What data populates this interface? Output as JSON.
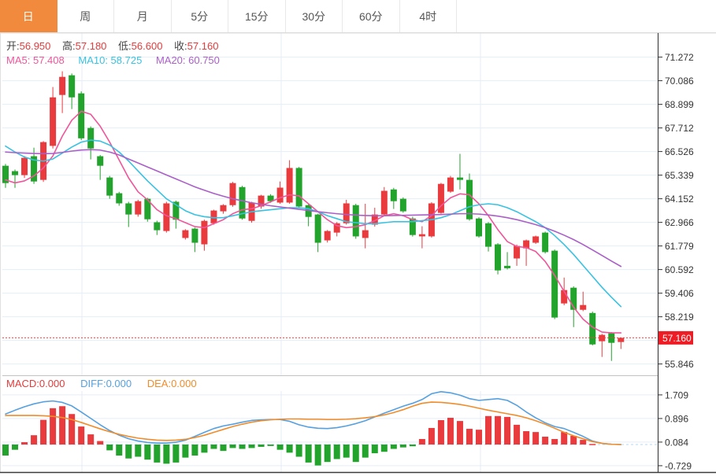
{
  "tabs": [
    {
      "label": "日",
      "key": "day",
      "active": true
    },
    {
      "label": "周",
      "key": "week",
      "active": false
    },
    {
      "label": "月",
      "key": "month",
      "active": false
    },
    {
      "label": "5分",
      "key": "5min",
      "active": false
    },
    {
      "label": "15分",
      "key": "15min",
      "active": false
    },
    {
      "label": "30分",
      "key": "30min",
      "active": false
    },
    {
      "label": "60分",
      "key": "60min",
      "active": false
    },
    {
      "label": "4时",
      "key": "4hour",
      "active": false
    }
  ],
  "ohlc_bar": {
    "open_label": "开:",
    "open": "56.950",
    "high_label": "高:",
    "high": "57.180",
    "low_label": "低:",
    "low": "56.600",
    "close_label": "收:",
    "close": "57.160"
  },
  "ma_legend": {
    "ma5_label": "MA5: ",
    "ma5": "57.408",
    "ma10_label": "MA10: ",
    "ma10": "58.725",
    "ma20_label": "MA20: ",
    "ma20": "60.750"
  },
  "macd_legend": {
    "macd_label": "MACD:",
    "macd": "0.000",
    "diff_label": "DIFF:",
    "diff": "0.000",
    "dea_label": "DEA:",
    "dea": "0.000"
  },
  "price_axis": {
    "ticks": [
      "71.272",
      "70.086",
      "68.899",
      "67.712",
      "66.526",
      "65.339",
      "64.152",
      "62.966",
      "61.779",
      "60.592",
      "59.406",
      "58.219",
      "55.846"
    ],
    "last_price_badge": "57.160"
  },
  "macd_axis": {
    "ticks": [
      "1.709",
      "0.896",
      "0.084",
      "-0.729"
    ]
  },
  "colors": {
    "up": "#e93a3e",
    "down": "#22a32b",
    "ma5": "#f0559a",
    "ma10": "#38c2e2",
    "ma20": "#aa5fc8",
    "diff": "#55a0e0",
    "dea": "#f08c2a",
    "tab_active": "#f28a3e",
    "badge": "#ee1c24",
    "grid": "#e4edf6",
    "axis_line": "#444444",
    "axis_text": "#333333",
    "dotted_line": "#ff3a3a",
    "zero_dash": "#b5d8f0",
    "ohlc_value": "#e33b3c",
    "macd_label": "#e23b3b"
  },
  "chart_data": [
    {
      "type": "candlestick",
      "title": "K-line daily panel",
      "legend_position": "top-left",
      "grid": true,
      "y_axis_ticks": [
        71.272,
        70.086,
        68.899,
        67.712,
        66.526,
        65.339,
        64.152,
        62.966,
        61.779,
        60.592,
        59.406,
        58.219,
        55.846
      ],
      "ylim": [
        55.25,
        72.45
      ],
      "current_price": 57.16,
      "candles_ohlc_hi_lo_close_format": "[open,high,low,close]",
      "candles": [
        [
          65.81,
          65.9,
          64.7,
          64.94
        ],
        [
          65.54,
          65.62,
          64.7,
          65.34
        ],
        [
          65.34,
          66.3,
          65.2,
          66.21
        ],
        [
          66.29,
          66.72,
          64.9,
          65.02
        ],
        [
          65.1,
          67.05,
          65.0,
          67.0
        ],
        [
          66.81,
          69.77,
          66.68,
          69.25
        ],
        [
          69.37,
          70.56,
          68.46,
          70.28
        ],
        [
          70.36,
          70.45,
          68.66,
          69.25
        ],
        [
          69.45,
          69.55,
          67.1,
          67.19
        ],
        [
          67.71,
          67.79,
          66.13,
          66.68
        ],
        [
          66.29,
          66.35,
          65.1,
          65.81
        ],
        [
          65.22,
          65.3,
          64.15,
          64.31
        ],
        [
          64.43,
          64.5,
          63.8,
          63.92
        ],
        [
          63.92,
          64.0,
          62.73,
          63.36
        ],
        [
          63.36,
          64.1,
          63.25,
          64.03
        ],
        [
          64.15,
          64.2,
          63.0,
          63.12
        ],
        [
          62.97,
          63.05,
          62.33,
          62.57
        ],
        [
          62.53,
          64.0,
          62.45,
          63.92
        ],
        [
          64.0,
          64.06,
          62.65,
          63.1
        ],
        [
          62.18,
          62.62,
          62.1,
          62.57
        ],
        [
          62.65,
          62.7,
          61.47,
          61.94
        ],
        [
          61.86,
          63.1,
          61.54,
          63.04
        ],
        [
          62.92,
          63.6,
          62.85,
          63.56
        ],
        [
          63.52,
          63.88,
          63.4,
          63.83
        ],
        [
          63.83,
          65.0,
          63.75,
          64.94
        ],
        [
          64.74,
          64.8,
          63.1,
          63.16
        ],
        [
          63.04,
          64.0,
          62.95,
          63.96
        ],
        [
          63.76,
          64.35,
          63.65,
          64.31
        ],
        [
          64.31,
          64.38,
          63.95,
          64.03
        ],
        [
          63.96,
          65.02,
          63.9,
          64.71
        ],
        [
          63.96,
          66.09,
          63.9,
          65.7
        ],
        [
          65.7,
          65.75,
          63.7,
          63.76
        ],
        [
          63.83,
          63.9,
          62.77,
          63.24
        ],
        [
          63.36,
          63.4,
          61.47,
          61.94
        ],
        [
          62.06,
          62.58,
          61.95,
          62.53
        ],
        [
          62.45,
          62.98,
          62.26,
          62.92
        ],
        [
          62.92,
          64.1,
          62.85,
          63.92
        ],
        [
          63.83,
          63.9,
          62.14,
          62.26
        ],
        [
          62.18,
          63.9,
          61.66,
          62.57
        ],
        [
          62.85,
          63.7,
          62.75,
          63.36
        ],
        [
          63.36,
          64.74,
          63.3,
          64.55
        ],
        [
          64.62,
          64.7,
          63.64,
          64.03
        ],
        [
          64.15,
          64.22,
          63.45,
          63.52
        ],
        [
          63.16,
          63.25,
          62.25,
          62.33
        ],
        [
          62.26,
          62.77,
          61.66,
          62.37
        ],
        [
          62.26,
          63.98,
          62.2,
          63.92
        ],
        [
          63.44,
          64.95,
          63.4,
          64.9
        ],
        [
          64.51,
          65.3,
          64.45,
          65.22
        ],
        [
          65.22,
          66.41,
          64.62,
          65.1
        ],
        [
          65.1,
          65.42,
          63.05,
          63.12
        ],
        [
          63.16,
          63.22,
          62.2,
          62.26
        ],
        [
          62.92,
          62.98,
          61.5,
          61.74
        ],
        [
          61.86,
          61.92,
          60.35,
          60.55
        ],
        [
          60.78,
          61.47,
          60.6,
          60.66
        ],
        [
          61.15,
          61.85,
          60.78,
          61.78
        ],
        [
          61.66,
          62.1,
          60.78,
          62.06
        ],
        [
          61.94,
          62.3,
          61.88,
          62.26
        ],
        [
          62.45,
          62.5,
          61.4,
          61.47
        ],
        [
          61.54,
          61.6,
          58.1,
          58.18
        ],
        [
          58.89,
          60.19,
          58.8,
          59.56
        ],
        [
          59.68,
          59.75,
          57.7,
          58.57
        ],
        [
          58.57,
          59.48,
          58.5,
          58.81
        ],
        [
          58.41,
          58.48,
          56.78,
          56.83
        ],
        [
          56.99,
          57.36,
          56.2,
          57.31
        ],
        [
          57.39,
          57.45,
          56.0,
          56.91
        ],
        [
          56.95,
          57.18,
          56.6,
          57.16
        ]
      ],
      "series": [
        {
          "name": "MA5",
          "values": [
            65.1,
            64.95,
            65.05,
            65.3,
            65.7,
            66.3,
            67.3,
            68.1,
            68.55,
            68.4,
            67.8,
            67.0,
            66.1,
            65.2,
            64.5,
            64.1,
            63.6,
            63.3,
            63.15,
            62.95,
            62.75,
            62.7,
            62.9,
            63.1,
            63.4,
            63.6,
            63.65,
            63.8,
            64.0,
            64.2,
            64.35,
            64.3,
            63.9,
            63.5,
            63.1,
            62.8,
            62.7,
            62.75,
            62.85,
            63.05,
            63.3,
            63.4,
            63.3,
            63.1,
            63.0,
            63.3,
            63.8,
            64.2,
            64.4,
            64.35,
            63.9,
            63.3,
            62.6,
            62.0,
            61.75,
            61.7,
            61.5,
            61.0,
            60.3,
            59.5,
            58.7,
            58.1,
            57.7,
            57.45,
            57.41,
            57.41
          ]
        },
        {
          "name": "MA10",
          "values": [
            66.8,
            66.5,
            66.25,
            66.1,
            66.05,
            66.15,
            66.45,
            66.75,
            67.0,
            67.1,
            67.05,
            66.85,
            66.5,
            66.05,
            65.55,
            65.05,
            64.6,
            64.15,
            63.85,
            63.55,
            63.35,
            63.25,
            63.2,
            63.2,
            63.3,
            63.4,
            63.5,
            63.55,
            63.6,
            63.65,
            63.7,
            63.7,
            63.65,
            63.5,
            63.3,
            63.15,
            63.0,
            62.95,
            62.9,
            62.9,
            62.95,
            63.0,
            63.0,
            63.0,
            63.05,
            63.1,
            63.2,
            63.35,
            63.55,
            63.75,
            63.85,
            63.9,
            63.85,
            63.7,
            63.5,
            63.25,
            63.0,
            62.7,
            62.3,
            61.85,
            61.35,
            60.8,
            60.25,
            59.7,
            59.2,
            58.73
          ]
        },
        {
          "name": "MA20",
          "values": [
            66.5,
            66.47,
            66.45,
            66.43,
            66.42,
            66.43,
            66.48,
            66.55,
            66.6,
            66.62,
            66.6,
            66.5,
            66.35,
            66.15,
            65.95,
            65.75,
            65.55,
            65.35,
            65.15,
            64.95,
            64.75,
            64.58,
            64.42,
            64.28,
            64.15,
            64.05,
            63.95,
            63.87,
            63.8,
            63.74,
            63.68,
            63.62,
            63.56,
            63.5,
            63.45,
            63.4,
            63.36,
            63.33,
            63.31,
            63.3,
            63.3,
            63.31,
            63.32,
            63.33,
            63.34,
            63.35,
            63.36,
            63.38,
            63.4,
            63.4,
            63.38,
            63.34,
            63.28,
            63.2,
            63.1,
            62.98,
            62.85,
            62.7,
            62.52,
            62.32,
            62.1,
            61.85,
            61.58,
            61.3,
            61.02,
            60.75
          ]
        }
      ]
    },
    {
      "type": "bar",
      "title": "MACD panel",
      "y_axis_ticks": [
        1.709,
        0.896,
        0.084,
        -0.729
      ],
      "ylim": [
        -1.0,
        1.95
      ],
      "histogram": [
        -0.38,
        -0.18,
        0.08,
        0.32,
        0.85,
        1.25,
        1.32,
        1.05,
        0.62,
        0.35,
        0.12,
        -0.2,
        -0.38,
        -0.48,
        -0.42,
        -0.52,
        -0.62,
        -0.66,
        -0.62,
        -0.45,
        -0.38,
        -0.28,
        -0.15,
        -0.22,
        -0.12,
        -0.15,
        -0.12,
        -0.08,
        -0.05,
        -0.18,
        -0.28,
        -0.42,
        -0.62,
        -0.72,
        -0.6,
        -0.5,
        -0.45,
        -0.6,
        -0.45,
        -0.3,
        -0.25,
        -0.15,
        -0.1,
        -0.06,
        0.19,
        0.57,
        0.84,
        0.92,
        0.81,
        0.54,
        0.51,
        0.98,
        0.98,
        0.95,
        0.68,
        0.46,
        0.43,
        0.27,
        0.19,
        0.43,
        0.3,
        0.16,
        0.02,
        0.01,
        0.0,
        0.0
      ],
      "series": [
        {
          "name": "DIFF",
          "values": [
            1.05,
            1.18,
            1.3,
            1.4,
            1.47,
            1.5,
            1.45,
            1.33,
            1.12,
            0.9,
            0.68,
            0.48,
            0.32,
            0.2,
            0.12,
            0.07,
            0.05,
            0.05,
            0.08,
            0.15,
            0.28,
            0.42,
            0.55,
            0.64,
            0.7,
            0.77,
            0.83,
            0.85,
            0.86,
            0.86,
            0.8,
            0.68,
            0.6,
            0.56,
            0.55,
            0.58,
            0.64,
            0.72,
            0.82,
            0.95,
            1.08,
            1.2,
            1.32,
            1.42,
            1.55,
            1.75,
            1.82,
            1.78,
            1.7,
            1.58,
            1.52,
            1.55,
            1.58,
            1.52,
            1.35,
            1.12,
            0.92,
            0.75,
            0.62,
            0.55,
            0.42,
            0.28,
            0.12,
            0.04,
            0.01,
            0.0
          ]
        },
        {
          "name": "DEA",
          "values": [
            1.0,
            1.0,
            1.0,
            1.0,
            0.99,
            0.97,
            0.93,
            0.86,
            0.76,
            0.65,
            0.54,
            0.44,
            0.35,
            0.28,
            0.22,
            0.18,
            0.15,
            0.14,
            0.15,
            0.18,
            0.24,
            0.32,
            0.42,
            0.52,
            0.62,
            0.7,
            0.77,
            0.82,
            0.85,
            0.87,
            0.88,
            0.88,
            0.87,
            0.87,
            0.86,
            0.86,
            0.87,
            0.89,
            0.92,
            0.96,
            1.02,
            1.1,
            1.2,
            1.32,
            1.42,
            1.46,
            1.45,
            1.42,
            1.38,
            1.32,
            1.25,
            1.18,
            1.12,
            1.06,
            1.0,
            0.92,
            0.82,
            0.7,
            0.56,
            0.42,
            0.3,
            0.2,
            0.1,
            0.04,
            0.01,
            0.0
          ]
        }
      ]
    }
  ]
}
